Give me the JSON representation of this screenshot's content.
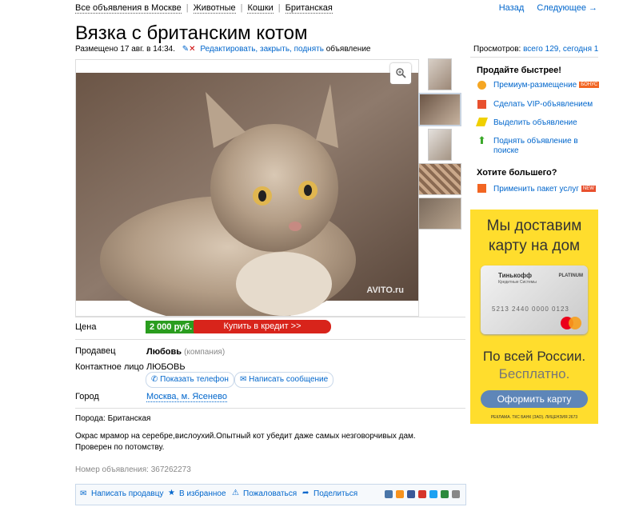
{
  "breadcrumbs": [
    "Все объявления в Москве",
    "Животные",
    "Кошки",
    "Британская"
  ],
  "nav": {
    "back": "Назад",
    "next": "Следующее →"
  },
  "title": "Вязка с британским котом",
  "meta": {
    "placed": "Размещено 17 авг. в 14:34.",
    "edit": "Редактировать, закрыть, поднять",
    "edit_suffix": "объявление"
  },
  "photo": {
    "watermark": "AVITO.ru"
  },
  "price": {
    "label": "Цена",
    "value": "2 000 руб.",
    "credit": "Купить в кредит >>"
  },
  "seller": {
    "label": "Продавец",
    "name": "Любовь",
    "type": "(компания)"
  },
  "contact": {
    "label": "Контактное лицо",
    "name": "ЛЮБОВЬ",
    "show_phone": "Показать телефон",
    "write": "Написать сообщение"
  },
  "city": {
    "label": "Город",
    "value": "Москва, м. Ясенево"
  },
  "breed": "Порода: Британская",
  "description": "Окрас мрамор на серебре,вислоухий.Опытный кот убедит даже самых незговорчивых дам. Проверен по потомству.",
  "ad_number": "Номер объявления: 367262273",
  "bottom": {
    "write_seller": "Написать продавцу",
    "favorites": "В избранное",
    "complain": "Пожаловаться",
    "share": "Поделиться"
  },
  "views": {
    "label": "Просмотров:",
    "value": "всего 129, сегодня 1"
  },
  "sell_faster": {
    "title": "Продайте быстрее!",
    "items": [
      {
        "label": "Премиум-размещение",
        "badge": "БОНУС"
      },
      {
        "label": "Сделать VIP-объявлением"
      },
      {
        "label": "Выделить объявление"
      },
      {
        "label": "Поднять объявление в поиске"
      }
    ]
  },
  "want_more": {
    "title": "Хотите большего?",
    "item": "Применить пакет услуг",
    "badge": "NEW"
  },
  "banner": {
    "line1": "Мы доставим",
    "line2": "карту на дом",
    "card_brand": "Тинькофф",
    "card_sub": "Кредитные Системы",
    "card_tier": "PLATINUM",
    "card_number": "5213 2440 0000 0123",
    "line3": "По всей России.",
    "line4": "Бесплатно.",
    "button": "Оформить карту",
    "fine": "РЕКЛАМА. ТКС БАНК (ЗАО). ЛИЦЕНЗИЯ 2673"
  },
  "colors": {
    "link": "#0066cc",
    "price_bg": "#2a9d1e",
    "credit_bg": "#d8241b",
    "banner_bg": "#ffdd2d",
    "banner_btn": "#5e86b8"
  }
}
